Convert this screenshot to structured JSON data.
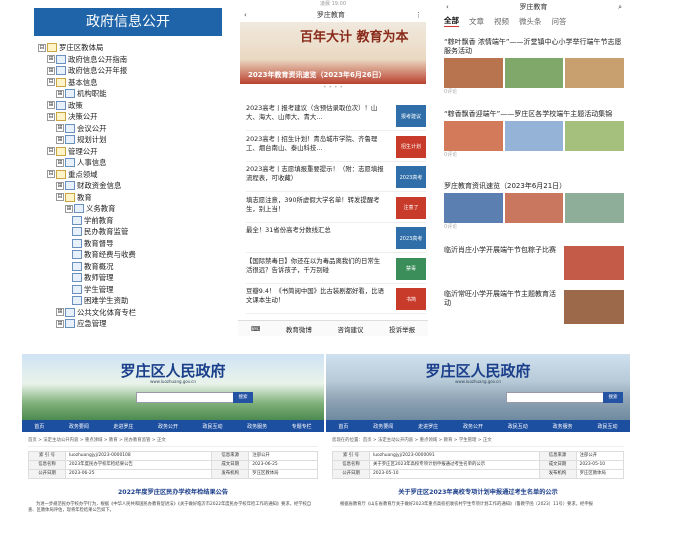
{
  "tree_panel": {
    "title": "政府信息公开",
    "nodes": [
      {
        "label": "罗庄区教体局",
        "box": "⊟",
        "icon": "open"
      },
      {
        "label": "政府信息公开指南",
        "box": "⊞",
        "icon": "closed"
      },
      {
        "label": "政府信息公开年报",
        "box": "⊞",
        "icon": "closed"
      },
      {
        "label": "基本信息",
        "box": "⊟",
        "icon": "open"
      },
      {
        "label": "机构职能",
        "box": "⊞",
        "icon": "closed"
      },
      {
        "label": "政策",
        "box": "⊞",
        "icon": "closed"
      },
      {
        "label": "决策公开",
        "box": "⊟",
        "icon": "open"
      },
      {
        "label": "会议公开",
        "box": "⊞",
        "icon": "closed"
      },
      {
        "label": "规划计划",
        "box": "⊞",
        "icon": "closed"
      },
      {
        "label": "管理公开",
        "box": "⊟",
        "icon": "open"
      },
      {
        "label": "人事信息",
        "box": "⊞",
        "icon": "closed"
      },
      {
        "label": "重点领域",
        "box": "⊟",
        "icon": "open"
      },
      {
        "label": "财政资金信息",
        "box": "⊞",
        "icon": "closed"
      },
      {
        "label": "教育",
        "box": "⊟",
        "icon": "open"
      },
      {
        "label": "义务教育",
        "box": "⊞",
        "icon": "closed"
      },
      {
        "label": "学前教育",
        "box": "",
        "icon": "closed"
      },
      {
        "label": "民办教育监管",
        "box": "",
        "icon": "closed"
      },
      {
        "label": "教育督导",
        "box": "",
        "icon": "closed"
      },
      {
        "label": "教育经费与收费",
        "box": "",
        "icon": "closed"
      },
      {
        "label": "教育概况",
        "box": "",
        "icon": "closed"
      },
      {
        "label": "教师管理",
        "box": "",
        "icon": "closed"
      },
      {
        "label": "学生管理",
        "box": "",
        "icon": "closed"
      },
      {
        "label": "困难学生资助",
        "box": "",
        "icon": "closed"
      },
      {
        "label": "公共文化体育专栏",
        "box": "⊞",
        "icon": "closed"
      },
      {
        "label": "应急管理",
        "box": "⊞",
        "icon": "closed"
      }
    ]
  },
  "phone_panel": {
    "time": "凌晨 19:00",
    "title": "罗庄教育",
    "menu": "⋮",
    "banner_big": "百年大计 教育为本",
    "banner_caption": "2023年教育资讯速览（2023年6月26日）",
    "news": [
      {
        "text": "2023高考丨报考建议（含预估录取位次）！山大、海大、山师大、青大…",
        "thumb": "报考建议"
      },
      {
        "text": "2023高考丨招生计划！青岛城市学院、齐鲁理工、烟台南山、泰山科技…",
        "thumb": "招生计划"
      },
      {
        "text": "2023高考丨志愿填报重要提示！（附：志愿填报流程表，可收藏）",
        "thumb": "2023高考"
      },
      {
        "text": "填志愿注意，390所虚假大学名单！转发提醒考生，别上当！",
        "thumb": "注意了"
      },
      {
        "text": "最全！31省份高考分数线汇总",
        "thumb": "2023高考"
      },
      {
        "text": "【国际禁毒日】你还在以为毒品离我们的日常生活很远？告诉孩子，千万别碰",
        "thumb": "禁毒"
      },
      {
        "text": "豆瓣9.4！《书简阅中国》比古装剧都好看，比语文课本生动！",
        "thumb": "书简"
      }
    ],
    "bottom": [
      "教育微博",
      "咨询建议",
      "投诉举报"
    ]
  },
  "article_panel": {
    "title": "罗庄教育",
    "tabs": [
      "全部",
      "文章",
      "视频",
      "微头条",
      "问答"
    ],
    "articles": [
      {
        "title": "“粽叶飘香 浓情端午”——沂堂镇中心小学举行端午节志愿服务活动",
        "meta": "0评论"
      },
      {
        "title": "“粽香飘香迎端午”——罗庄区各学校端午主题活动集锦",
        "meta": "0评论"
      },
      {
        "title": "罗庄教育资讯速览（2023年6月21日）",
        "meta": "0评论"
      },
      {
        "title": "临沂肖庄小学开展端午节包粽子比赛",
        "meta": "0评论"
      },
      {
        "title": "临沂常旺小学开展端午节主题教育活动",
        "meta": "0评论"
      }
    ]
  },
  "gov_left": {
    "site_title": "罗庄区人民政府",
    "url": "www.luozhuang.gov.cn",
    "search_btn": "搜索",
    "nav": [
      "首页",
      "政务要闻",
      "走进罗庄",
      "政务公开",
      "政民互动",
      "政务服务",
      "专题专栏"
    ],
    "crumb": "首页 > 法定主动公开内容 > 重点领域 > 教育 > 民办教育监管 > 正文",
    "meta": [
      [
        "索 引 号",
        "luozhuangjyj/2023-0000108",
        "信息来源",
        "注部公开"
      ],
      [
        "信息名称",
        "2023年度民办学校年检结果公告",
        "成文日期",
        "2023-06-25"
      ],
      [
        "公开日期",
        "2023-06-25",
        "发布机构",
        "罗庄区教体局"
      ]
    ],
    "heading": "2022年度罗庄区民办学校年检结果公告",
    "text": "为进一步规范民办学校办学行为，根据《中华人民共和国民办教育促进法》《关于做好临沂市2022年度民办学校年检工作的通知》要求，经学校自查、区教体局评估，现将年检结果公告如下。"
  },
  "gov_right": {
    "site_title": "罗庄区人民政府",
    "url": "www.luozhuang.gov.cn",
    "search_btn": "搜索",
    "nav": [
      "首页",
      "政务要闻",
      "走进罗庄",
      "政务公开",
      "政民互动",
      "政务服务",
      "政民互动"
    ],
    "crumb": "您现在的位置：首页 > 法定主动公开内容 > 重点领域 > 教育 > 学生管理 > 正文",
    "meta": [
      [
        "索 引 号",
        "luozhuangjyj/2023-0000091",
        "信息来源",
        "注部公开"
      ],
      [
        "信息名称",
        "关于罗庄区2023年高校专项计划申报通过考生名单的公示",
        "成文日期",
        "2023-05-10"
      ],
      [
        "公开日期",
        "2023-05-10",
        "发布机构",
        "罗庄区教体局"
      ]
    ],
    "heading": "关于罗庄区2023年高校专项计划申报通过考生名单的公示",
    "text": "根据省教育厅《山东省教育厅关于做好2023年重点高校招收农村学生专项计划工作的通知》（鲁教学函〔2023〕11号）要求，经申报"
  }
}
